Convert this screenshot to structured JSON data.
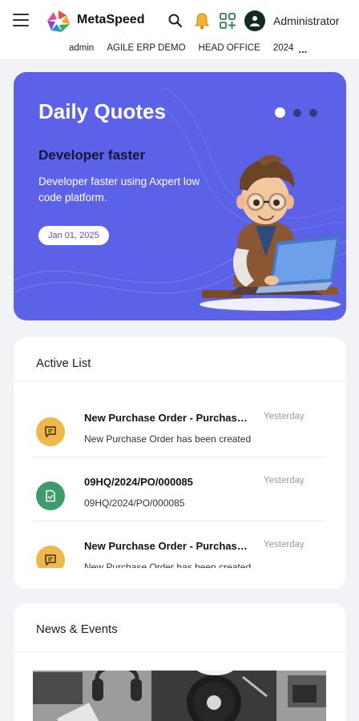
{
  "header": {
    "app_title": "MetaSpeed",
    "user_name": "Administrator",
    "icons": [
      "menu-icon",
      "metaspeed-logo",
      "search-icon",
      "bell-icon",
      "apps-add-icon",
      "user-avatar-icon"
    ],
    "breadcrumbs": [
      "admin",
      "AGILE ERP DEMO",
      "HEAD OFFICE",
      "2024"
    ],
    "more_label": "..."
  },
  "quotes": {
    "title": "Daily Quotes",
    "subtitle": "Developer faster",
    "text": "Developer faster using Axpert low code platform.",
    "date": "Jan 01, 2025",
    "slide_count": 3,
    "active_slide": 1,
    "colors": {
      "background": "#5b62e8",
      "dot_inactive": "#2d3a86"
    }
  },
  "active_list": {
    "title": "Active List",
    "items": [
      {
        "title": "New Purchase Order - Purchase Order",
        "desc": "New Purchase Order has been created",
        "time": "Yesterday",
        "icon": "message-icon",
        "color": "#f0b74a"
      },
      {
        "title": "09HQ/2024/PO/000085",
        "desc": "09HQ/2024/PO/000085",
        "time": "Yesterday",
        "icon": "document-check-icon",
        "color": "#3d9a6a"
      },
      {
        "title": "New Purchase Order - Purchase Order",
        "desc": "New Purchase Order has been created",
        "time": "Yesterday",
        "icon": "message-icon",
        "color": "#f0b74a"
      }
    ]
  },
  "news": {
    "title": "News & Events"
  }
}
